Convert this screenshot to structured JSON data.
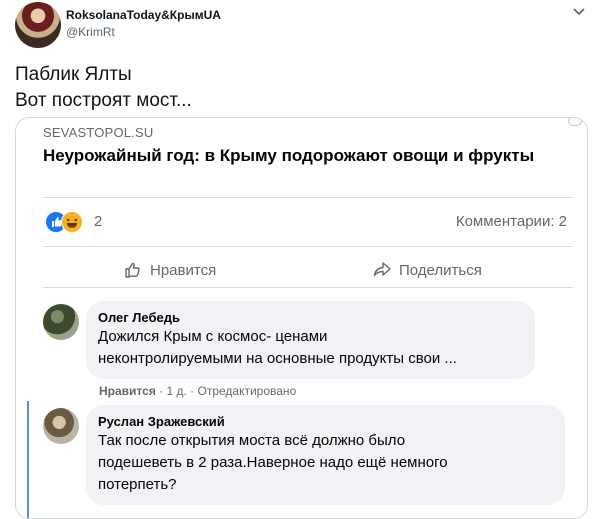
{
  "tweet": {
    "display_name": "RoksolanaToday&КрымUA",
    "handle": "@KrimRt",
    "text_line1": "Паблик Ялты",
    "text_line2": "Вот построят мост..."
  },
  "post": {
    "domain": "SEVASTOPOL.SU",
    "title": "Неурожайный год: в Крыму подорожают овощи и фрукты",
    "reaction_icons": [
      "like-icon",
      "haha-icon"
    ],
    "reaction_count": "2",
    "comments_label": "Комментарии: 2",
    "like_label": "Нравится",
    "share_label": "Поделиться"
  },
  "comments": [
    {
      "author": "Олег Лебедь",
      "line1": "Дожился Крым с космос- ценами",
      "line2": "неконтролируемыми на основные продукты свои ...",
      "like_label": "Нравится",
      "meta": " · 1 д. · Отредактировано"
    },
    {
      "author": "Руслан Зражевский",
      "line1": "Так после открытия моста всё должно было",
      "line2": "подешеветь в 2 раза.Наверное надо ещё немного",
      "line3": "потерпеть?"
    }
  ],
  "colors": {
    "accent": "#1877f2",
    "haha": "#f7b125",
    "thread_line": "#5b8ed8"
  }
}
